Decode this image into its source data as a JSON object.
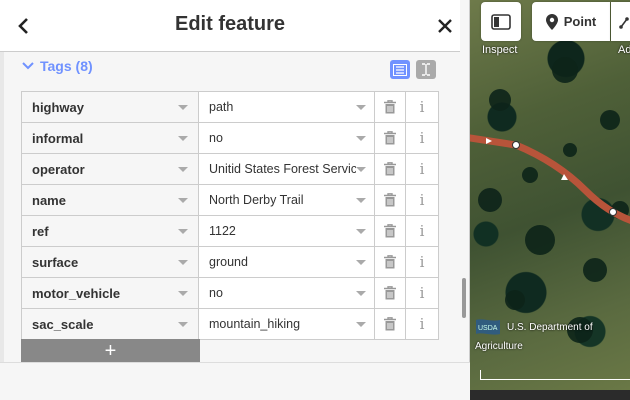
{
  "header": {
    "title": "Edit feature",
    "back_label": "<"
  },
  "tags": {
    "section_label": "Tags (8)",
    "rows": [
      {
        "key": "highway",
        "value": "path"
      },
      {
        "key": "informal",
        "value": "no"
      },
      {
        "key": "operator",
        "value": "Unitid States Forest Service"
      },
      {
        "key": "name",
        "value": "North Derby Trail"
      },
      {
        "key": "ref",
        "value": "1122"
      },
      {
        "key": "surface",
        "value": "ground"
      },
      {
        "key": "motor_vehicle",
        "value": "no"
      },
      {
        "key": "sac_scale",
        "value": "mountain_hiking"
      }
    ],
    "info_glyph": "i",
    "add_label": "+"
  },
  "map": {
    "inspect_label": "Inspect",
    "point_label": "Point",
    "add_label_partial": "Ad",
    "attribution_line1": "U.S. Department of",
    "attribution_line2": "Agriculture",
    "usda_logo_text": "USDA"
  },
  "colors": {
    "accent": "#7092ff",
    "trail": "#b8543a"
  }
}
